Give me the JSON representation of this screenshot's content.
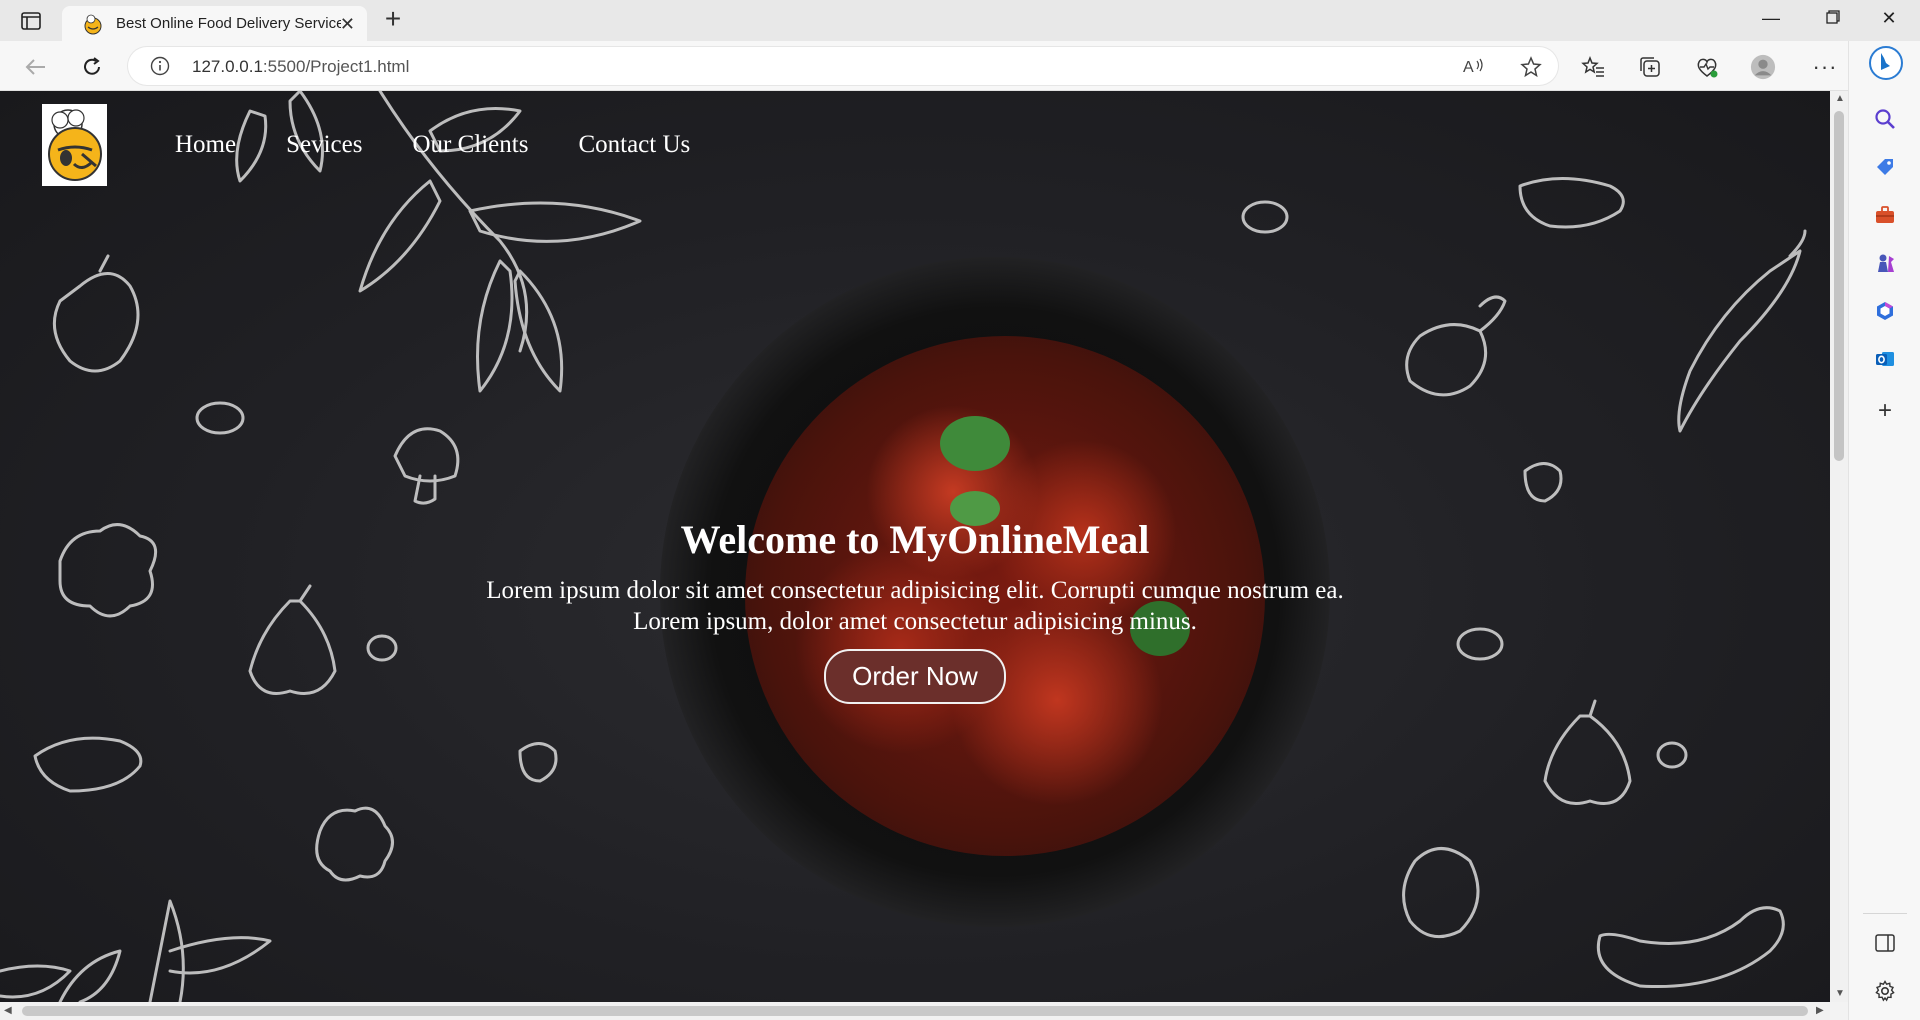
{
  "browser": {
    "tab_title": "Best Online Food Delivery Service",
    "url_host": "127.0.0.1",
    "url_path": ":5500/Project1.html"
  },
  "site": {
    "nav": [
      "Home",
      "Sevices",
      "Our Clients",
      "Contact Us"
    ],
    "hero": {
      "title": "Welcome to MyOnlineMeal",
      "text_line1": "Lorem ipsum dolor sit amet consectetur adipisicing elit. Corrupti cumque nostrum ea.",
      "text_line2": "Lorem ipsum, dolor amet consectetur adipisicing minus.",
      "button_label": "Order Now"
    }
  },
  "colors": {
    "page_bg": "#1f1f23",
    "button_bg": "#6b2f2b",
    "accent_logo": "#f5b41a"
  }
}
